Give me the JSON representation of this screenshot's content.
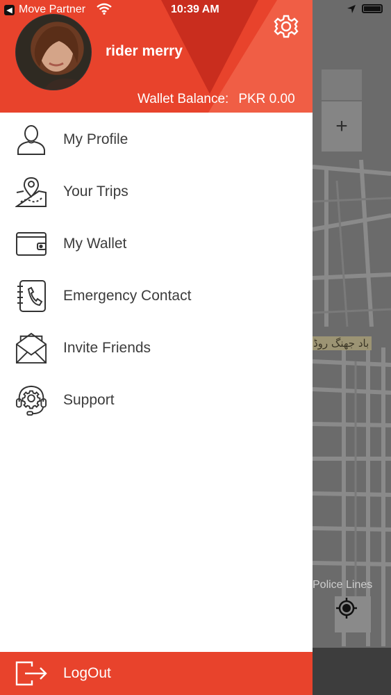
{
  "status_bar": {
    "back_app": "Move Partner",
    "time": "10:39 AM"
  },
  "drawer": {
    "username": "rider merry",
    "wallet_label": "Wallet Balance:",
    "wallet_amount": "PKR 0.00",
    "menu": [
      {
        "label": "My Profile",
        "icon": "profile-icon"
      },
      {
        "label": "Your Trips",
        "icon": "map-pin-icon"
      },
      {
        "label": "My Wallet",
        "icon": "wallet-icon"
      },
      {
        "label": "Emergency Contact",
        "icon": "phone-book-icon"
      },
      {
        "label": "Invite Friends",
        "icon": "envelope-icon"
      },
      {
        "label": "Support",
        "icon": "support-headset-icon"
      }
    ],
    "logout_label": "LogOut"
  },
  "map": {
    "zoom_in_label": "+",
    "road_label": "باد جهنگ روڈ",
    "police_label": "Police Lines"
  },
  "colors": {
    "accent": "#e8432c",
    "accent_dark": "#c92d1e",
    "accent_light": "#f05e45",
    "map_bg": "#6b6b6b"
  }
}
